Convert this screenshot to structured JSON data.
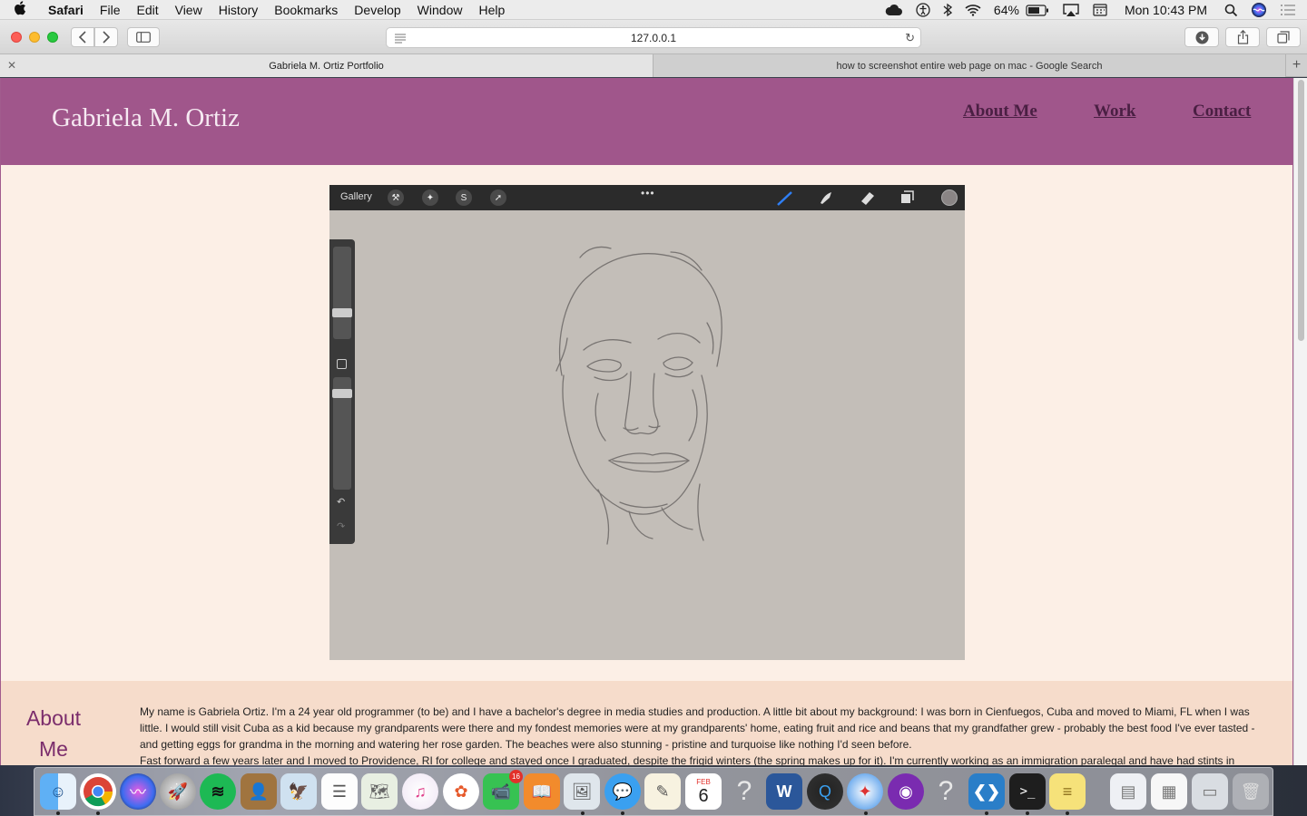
{
  "menubar": {
    "app_name": "Safari",
    "items": [
      "File",
      "Edit",
      "View",
      "History",
      "Bookmarks",
      "Develop",
      "Window",
      "Help"
    ],
    "battery": "64%",
    "clock": "Mon 10:43 PM"
  },
  "browser": {
    "url": "127.0.0.1",
    "tabs": [
      {
        "title": "Gabriela M. Ortiz Portfolio",
        "active": true
      },
      {
        "title": "how to screenshot entire web page on mac - Google Search",
        "active": false
      }
    ]
  },
  "site": {
    "title": "Gabriela M. Ortiz",
    "nav": [
      "About Me",
      "Work",
      "Contact"
    ],
    "artwork": {
      "app_gallery_label": "Gallery"
    },
    "about": {
      "heading_line1": "About",
      "heading_line2": "Me",
      "paragraph1": "My name is Gabriela Ortiz. I'm a 24 year old programmer (to be) and I have a bachelor's degree in media studies and production. A little bit about my background: I was born in Cienfuegos, Cuba and moved to Miami, FL when I was little. I would still visit Cuba as a kid because my grandparents were there and my fondest memories were at my grandparents' home, eating fruit and rice and beans that my grandfather grew - probably the best food I've ever tasted - and getting eggs for grandma in the morning and watering her rose garden. The beaches were also stunning - pristine and turquoise like nothing I'd seen before.",
      "paragraph2": "Fast forward a few years later and I moved to Providence, RI for college and stayed once I graduated, despite the frigid winters (the spring makes up for it). I'm currently working as an immigration paralegal and have had stints in"
    }
  },
  "dock": {
    "calendar_month": "FEB",
    "calendar_day": "6",
    "facetime_badge": "16",
    "colors": {
      "header": "#a0568b",
      "page_bg": "#fcefe6",
      "about_bg": "#f6dccb"
    }
  }
}
